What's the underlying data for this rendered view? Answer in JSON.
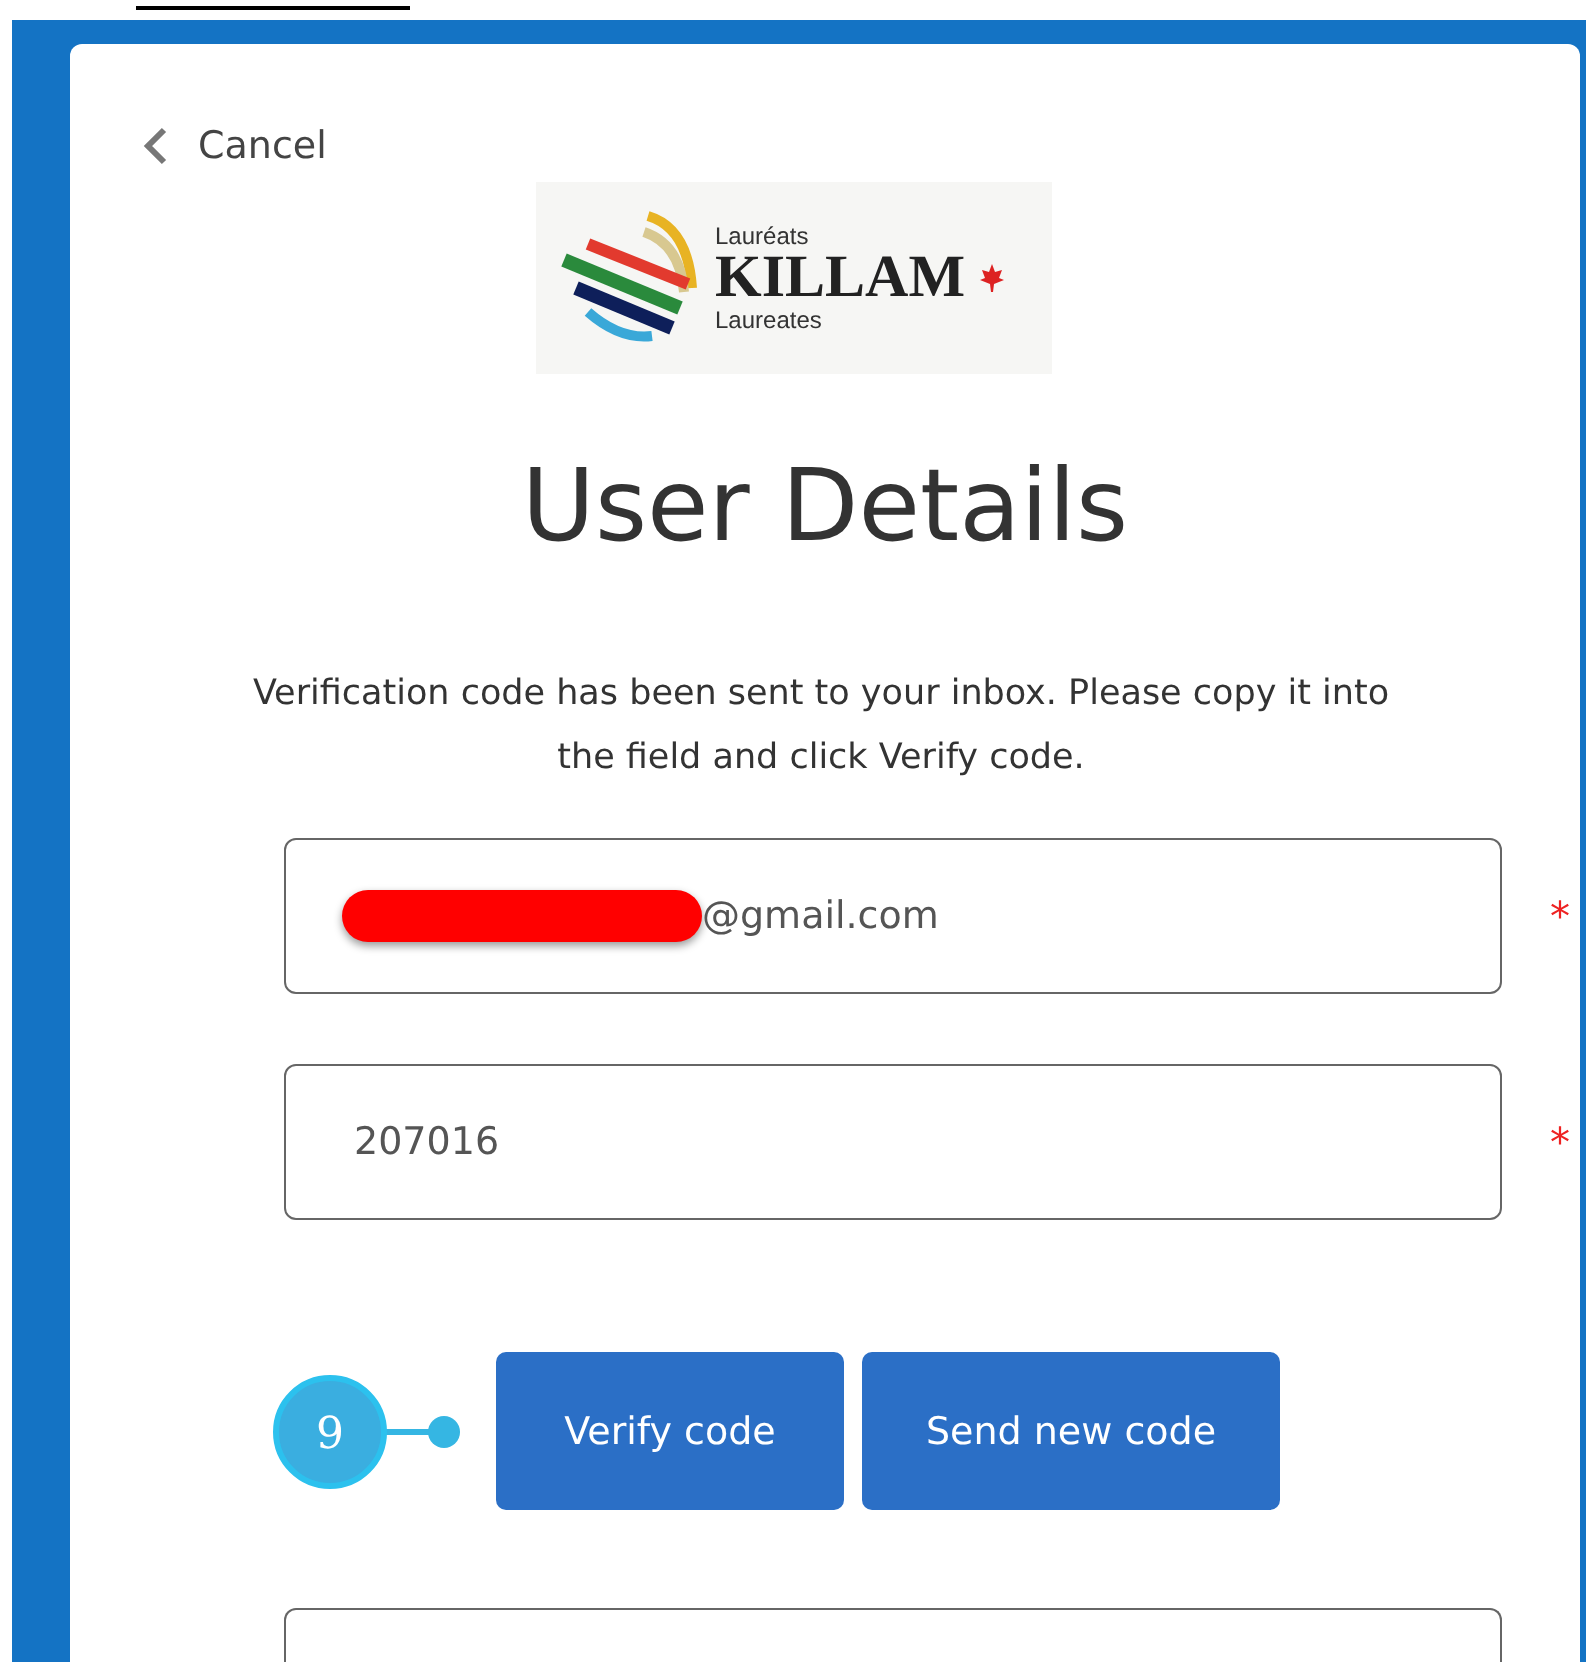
{
  "cancel": {
    "label": "Cancel"
  },
  "logo": {
    "top": "Lauréats",
    "name": "KILLAM",
    "bottom": "Laureates"
  },
  "title": "User Details",
  "message": "Verification code has been sent to your inbox. Please copy it into the field and click Verify code.",
  "fields": [
    {
      "value": "@gmail.com",
      "redacted": true,
      "required_mark": "*"
    },
    {
      "value": "207016",
      "redacted": false,
      "required_mark": "*"
    }
  ],
  "buttons": [
    {
      "label": "Verify code",
      "annotation": "9"
    },
    {
      "label": "Send new code"
    }
  ]
}
